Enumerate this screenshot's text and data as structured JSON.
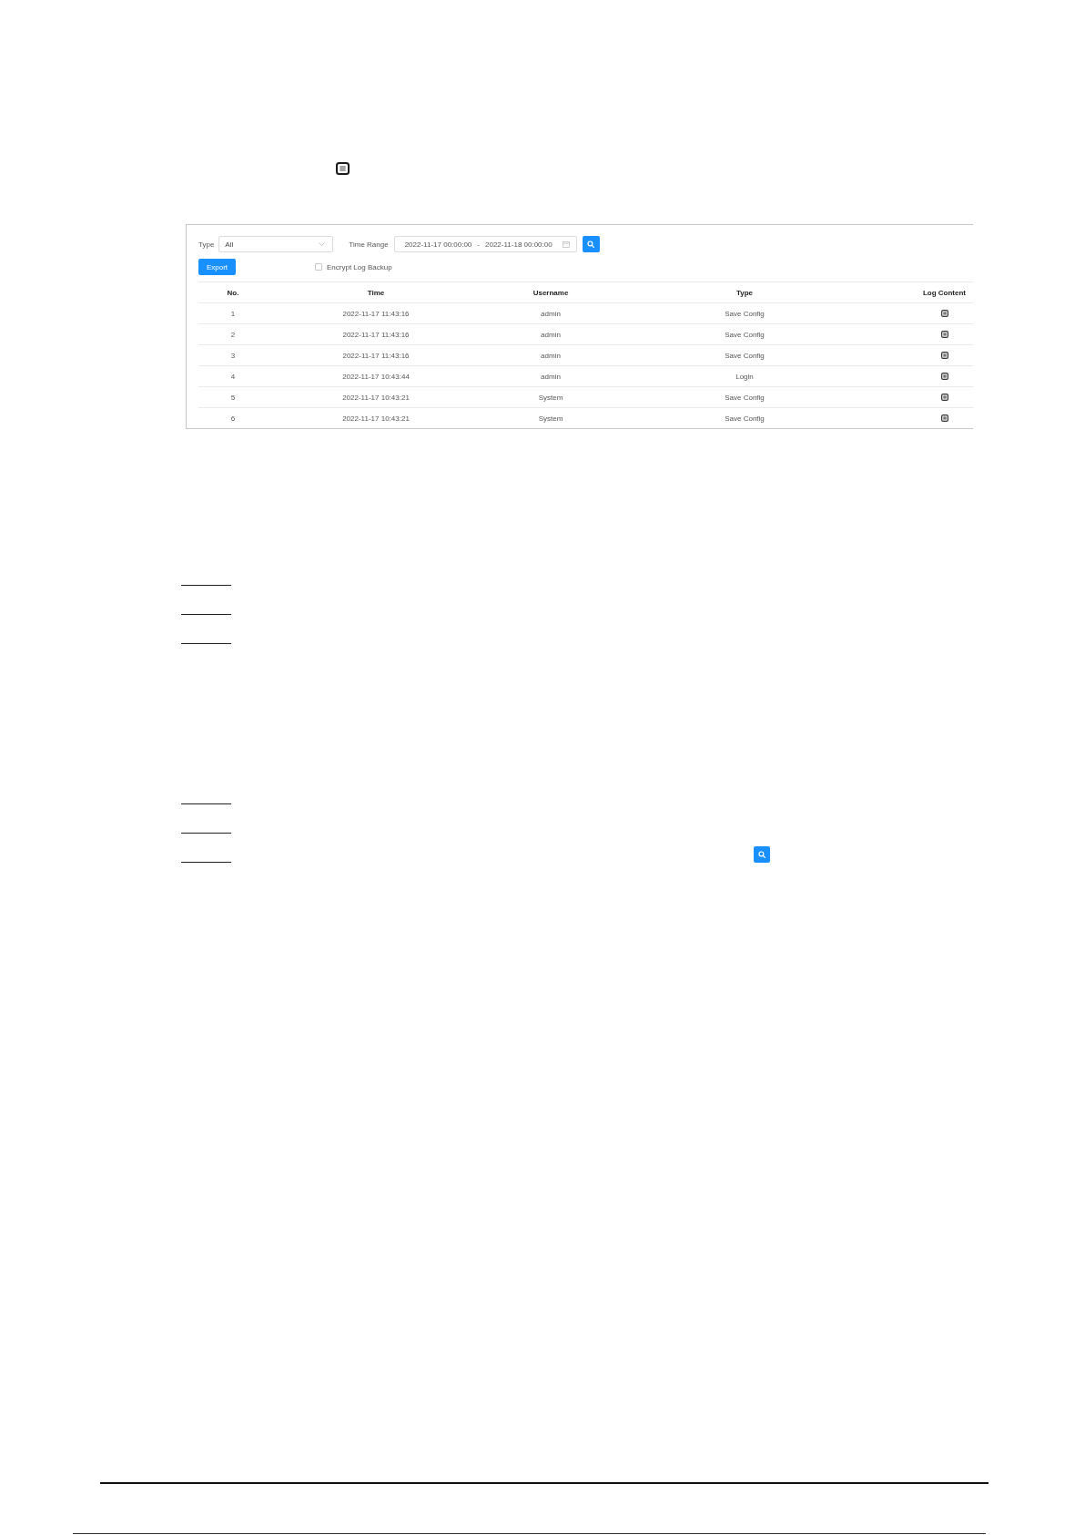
{
  "log_panel": {
    "filters": {
      "type_label": "Type",
      "type_value": "All",
      "time_range_label": "Time Range",
      "time_start": "2022-11-17 00:00:00",
      "time_separator": "-",
      "time_end": "2022-11-18 00:00:00"
    },
    "export_button": "Export",
    "encrypt_log_backup": {
      "label": "Encrypt Log Backup",
      "checked": false
    },
    "table": {
      "columns": [
        "No.",
        "Time",
        "Username",
        "Type",
        "Log Content"
      ],
      "rows": [
        {
          "no": "1",
          "time": "2022-11-17 11:43:16",
          "username": "admin",
          "type": "Save Config"
        },
        {
          "no": "2",
          "time": "2022-11-17 11:43:16",
          "username": "admin",
          "type": "Save Config"
        },
        {
          "no": "3",
          "time": "2022-11-17 11:43:16",
          "username": "admin",
          "type": "Save Config"
        },
        {
          "no": "4",
          "time": "2022-11-17 10:43:44",
          "username": "admin",
          "type": "Login"
        },
        {
          "no": "5",
          "time": "2022-11-17 10:43:21",
          "username": "System",
          "type": "Save Config"
        },
        {
          "no": "6",
          "time": "2022-11-17 10:43:21",
          "username": "System",
          "type": "Save Config"
        }
      ]
    }
  }
}
